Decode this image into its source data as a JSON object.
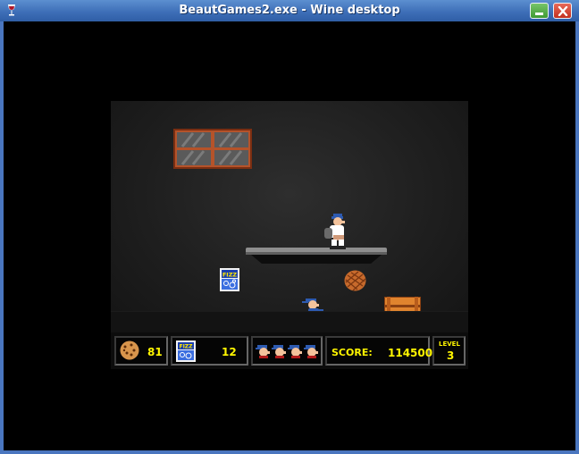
{
  "window": {
    "title": "BeautGames2.exe - Wine desktop"
  },
  "hud": {
    "cookies": "81",
    "fizz": "12",
    "lives": 4,
    "score_label": "SCORE:",
    "score": "114500",
    "level_label": "LEVEL",
    "level": "3"
  },
  "sprites": {
    "fizz_can_text": "FIZZ",
    "hud_fizz_text": "FIZZ"
  },
  "colors": {
    "hud_text": "#fff600",
    "titlebar": "#3e6fb8"
  }
}
